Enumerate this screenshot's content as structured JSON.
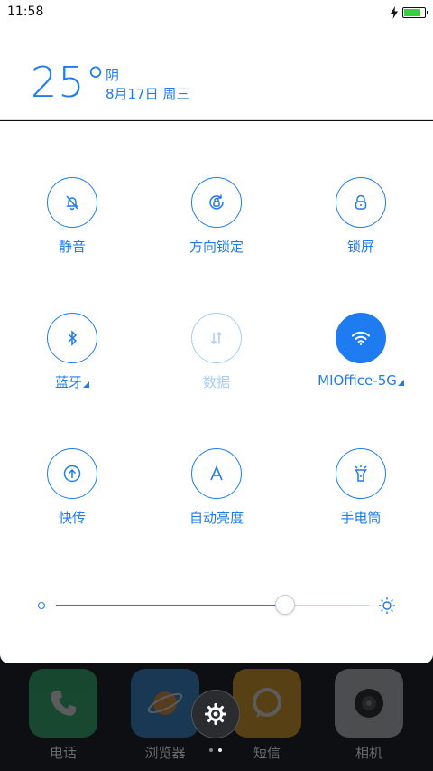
{
  "status_bar": {
    "time": "11:58",
    "battery_level": 0.85,
    "charging": true
  },
  "weather": {
    "temperature": "25°",
    "condition": "阴",
    "date": "8月17日 周三"
  },
  "toggles": [
    {
      "id": "silent",
      "label": "静音",
      "icon": "bell-mute-icon",
      "state": "off"
    },
    {
      "id": "rotation-lock",
      "label": "方向锁定",
      "icon": "rotation-lock-icon",
      "state": "off"
    },
    {
      "id": "lock-screen",
      "label": "锁屏",
      "icon": "padlock-icon",
      "state": "off"
    },
    {
      "id": "bluetooth",
      "label": "蓝牙",
      "icon": "bluetooth-icon",
      "state": "off",
      "expandable": true
    },
    {
      "id": "mobile-data",
      "label": "数据",
      "icon": "data-arrows-icon",
      "state": "disabled"
    },
    {
      "id": "wifi",
      "label": "MIOffice-5G",
      "icon": "wifi-icon",
      "state": "on",
      "expandable": true
    },
    {
      "id": "quick-share",
      "label": "快传",
      "icon": "quick-share-icon",
      "state": "off"
    },
    {
      "id": "auto-brightness",
      "label": "自动亮度",
      "icon": "auto-brightness-icon",
      "state": "off"
    },
    {
      "id": "flashlight",
      "label": "手电筒",
      "icon": "flashlight-icon",
      "state": "off"
    }
  ],
  "brightness": {
    "level": 0.73
  },
  "dock": {
    "apps": [
      {
        "id": "phone",
        "label": "电话",
        "icon": "phone-icon",
        "color": "#2fbf71"
      },
      {
        "id": "browser",
        "label": "浏览器",
        "icon": "browser-planet-icon",
        "color": "#2e8fe0"
      },
      {
        "id": "messages",
        "label": "短信",
        "icon": "message-bubble-icon",
        "color": "#f3a81c"
      },
      {
        "id": "camera",
        "label": "相机",
        "icon": "camera-icon",
        "color": "#cfcfcf"
      }
    ],
    "page_indicator": {
      "pages": 2,
      "current": 1
    }
  },
  "colors": {
    "accent": "#1e7cf0",
    "accent_disabled": "#a8ccf7",
    "battery_green": "#35d03a"
  }
}
